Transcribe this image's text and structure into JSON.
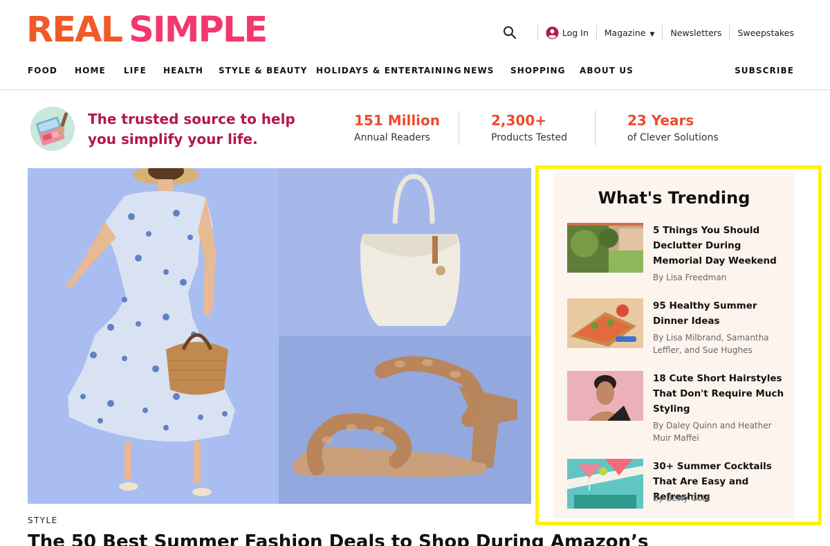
{
  "brand": {
    "word1": "REAL",
    "word2": "SIMPLE"
  },
  "utility": {
    "login": "Log In",
    "magazine": "Magazine",
    "newsletters": "Newsletters",
    "sweepstakes": "Sweepstakes"
  },
  "nav": {
    "items": [
      "FOOD",
      "HOME",
      "LIFE",
      "HEALTH",
      "STYLE & BEAUTY",
      "HOLIDAYS & ENTERTAINING",
      "NEWS",
      "SHOPPING",
      "ABOUT US"
    ],
    "subscribe": "SUBSCRIBE"
  },
  "promo": {
    "tagline": "The trusted source to help you simplify your life.",
    "stats": [
      {
        "number": "151 Million",
        "label": "Annual Readers"
      },
      {
        "number": "2,300+",
        "label": "Products Tested"
      },
      {
        "number": "23 Years",
        "label": "of Clever Solutions"
      }
    ]
  },
  "feature": {
    "section": "STYLE",
    "headline": "The 50 Best Summer Fashion Deals to Shop During Amazon’s"
  },
  "trending": {
    "heading": "What's Trending",
    "items": [
      {
        "title": "5 Things You Should Declutter During Memorial Day Weekend",
        "byline": "By Lisa Freedman"
      },
      {
        "title": "95 Healthy Summer Dinner Ideas",
        "byline": "By Lisa Milbrand, Samantha Leffler, and Sue Hughes"
      },
      {
        "title": "18 Cute Short Hairstyles That Don't Require Much Styling",
        "byline": "By Daley Quinn and Heather Muir Maffei"
      },
      {
        "title": "30+ Summer Cocktails That Are Easy and Refreshing",
        "byline": "By Betty Gold"
      }
    ]
  },
  "colors": {
    "brand_orange": "#f05a28",
    "brand_pink": "#f2386e",
    "tagline": "#b3174b",
    "stat": "#ef4a2d",
    "highlight": "#fff200",
    "trending_bg": "#fdf4ee"
  }
}
